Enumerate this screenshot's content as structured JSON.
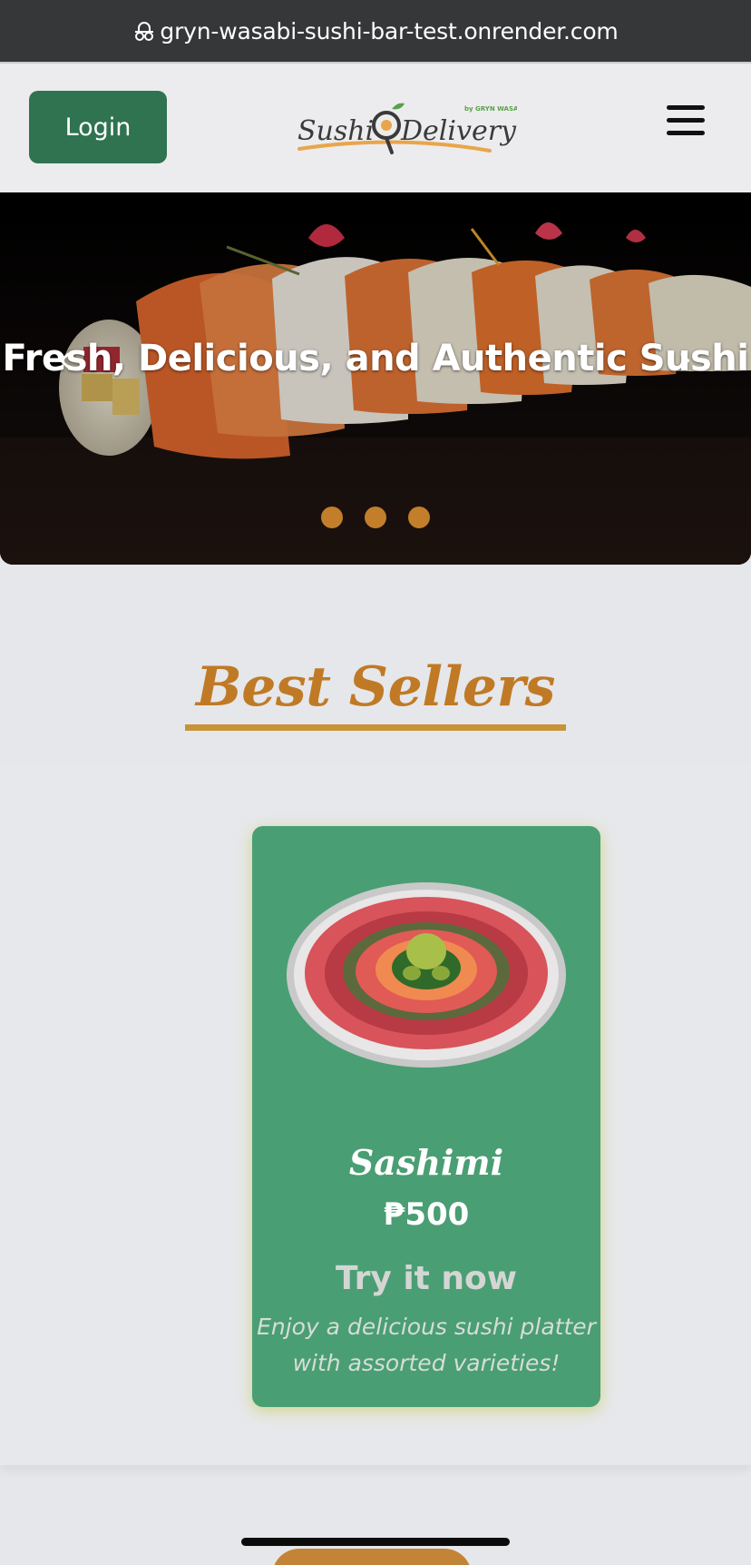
{
  "browser": {
    "url": "gryn-wasabi-sushi-bar-test.onrender.com",
    "icon": "incognito-lock-icon"
  },
  "header": {
    "login_label": "Login",
    "logo_text": "Sushi Delivery",
    "logo_byline": "by GRYN WASABI",
    "menu_icon": "hamburger-menu-icon"
  },
  "hero": {
    "title": "Fresh, Delicious, and Authentic Sushi",
    "prev_icon": "chevron-left-icon",
    "next_icon": "chevron-right-icon",
    "prev_glyph": "‹",
    "next_glyph": "›",
    "slides_count": 3,
    "dot_color": "#c27e2b"
  },
  "best_sellers": {
    "title": "Best Sellers",
    "items": [
      {
        "name": "Sashimi",
        "price": "₱500",
        "cta": "Try it now",
        "description": "Enjoy a delicious sushi platter with assorted varieties!"
      }
    ]
  },
  "colors": {
    "brand_green": "#2f7350",
    "card_green": "#4a9e73",
    "accent_gold": "#c07a25"
  }
}
